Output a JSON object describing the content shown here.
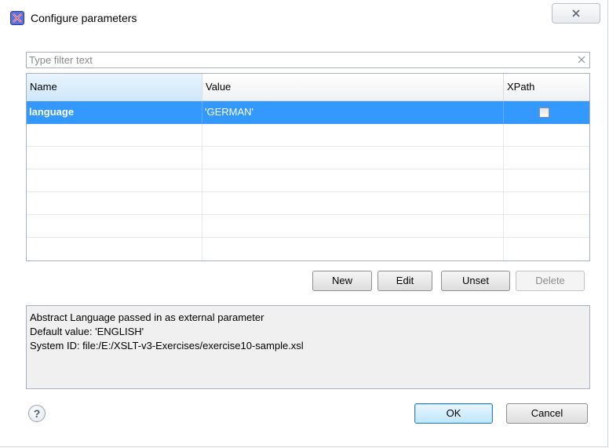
{
  "window": {
    "title": "Configure parameters",
    "close_glyph": "X"
  },
  "filter": {
    "placeholder": "Type filter text",
    "value": ""
  },
  "table": {
    "columns": [
      "Name",
      "Value",
      "XPath"
    ],
    "rows": [
      {
        "name": "language",
        "value": "'GERMAN'",
        "xpath": false,
        "selected": true
      }
    ]
  },
  "actions": {
    "new_label": "New",
    "edit_label": "Edit",
    "unset_label": "Unset",
    "delete_label": "Delete"
  },
  "description": {
    "line1": "Abstract Language passed in as external parameter",
    "line2": "Default value: 'ENGLISH'",
    "line3": "System ID: file:/E:/XSLT-v3-Exercises/exercise10-sample.xsl"
  },
  "footer": {
    "help_glyph": "?",
    "ok_label": "OK",
    "cancel_label": "Cancel"
  },
  "colors": {
    "selection": "#3399ff",
    "app_icon": "#5b6fd9"
  },
  "icons": [
    "app-logo-icon",
    "close-icon",
    "clear-filter-icon",
    "help-icon",
    "checkbox"
  ]
}
